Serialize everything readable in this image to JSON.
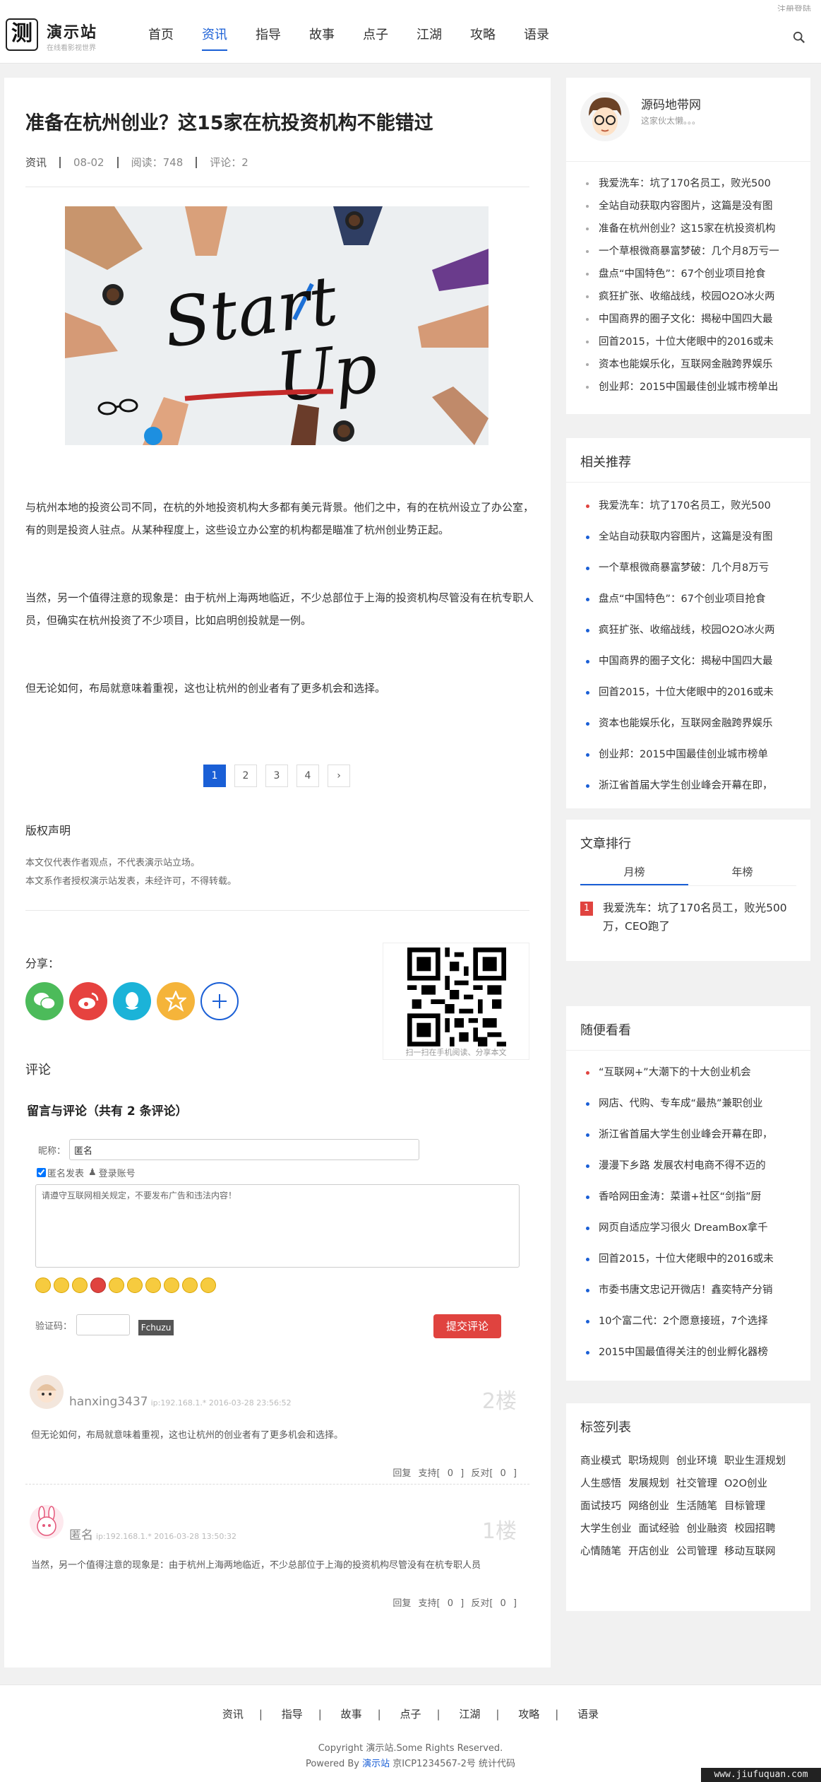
{
  "topbar": {
    "register_login": "注册登陆"
  },
  "logo": {
    "glyph": "测",
    "name": "演示站",
    "sub": "在线看影视世界"
  },
  "nav": {
    "items": [
      "首页",
      "资讯",
      "指导",
      "故事",
      "点子",
      "江湖",
      "攻略",
      "语录"
    ],
    "active_index": 1
  },
  "article": {
    "title": "准备在杭州创业？这15家在杭投资机构不能错过",
    "meta": {
      "category": "资讯",
      "date": "08-02",
      "reads": "阅读：748",
      "comments": "评论：2"
    },
    "hero_text": {
      "line1": "Start",
      "line2": "Up"
    },
    "paragraphs": [
      "与杭州本地的投资公司不同，在杭的外地投资机构大多都有美元背景。他们之中，有的在杭州设立了办公室，有的则是投资人驻点。从某种程度上，这些设立办公室的机构都是瞄准了杭州创业势正起。",
      "当然，另一个值得注意的现象是：由于杭州上海两地临近，不少总部位于上海的投资机构尽管没有在杭专职人员，但确实在杭州投资了不少项目，比如启明创投就是一例。",
      "但无论如何，布局就意味着重视，这也让杭州的创业者有了更多机会和选择。"
    ],
    "pager": [
      "1",
      "2",
      "3",
      "4",
      "›"
    ],
    "copyright": {
      "heading": "版权声明",
      "line1": "本文仅代表作者观点，不代表演示站立场。",
      "line2": "本文系作者授权演示站发表，未经许可，不得转载。"
    },
    "share": {
      "label": "分享：",
      "qr_caption": "扫一扫在手机阅读、分享本文"
    }
  },
  "comments": {
    "section_title": "评论",
    "heading": "留言与评论（共有 2 条评论）",
    "nick_label": "昵称：",
    "nick_value": "匿名",
    "anon_label": "匿名发表",
    "login_label": "登录账号",
    "textarea_placeholder": "请遵守互联网相关规定，不要发布广告和违法内容！",
    "captcha_label": "验证码：",
    "captcha_img": "Fchuzu",
    "submit_label": "提交评论",
    "items": [
      {
        "name": "hanxing3437",
        "ip": "ip:192.168.1.* 2016-03-28 23:56:52",
        "floor": "2楼",
        "text": "但无论如何，布局就意味着重视，这也让杭州的创业者有了更多机会和选择。",
        "actions": "回复 支持[ 0 ] 反对[ 0 ]"
      },
      {
        "name": "匿名",
        "ip": "ip:192.168.1.* 2016-03-28 13:50:32",
        "floor": "1楼",
        "text": "当然，另一个值得注意的现象是：由于杭州上海两地临近，不少总部位于上海的投资机构尽管没有在杭专职人员",
        "actions": "回复 支持[ 0 ] 反对[ 0 ]"
      }
    ]
  },
  "sidebar": {
    "profile": {
      "name": "源码地带网",
      "bio": "这家伙太懒。。。"
    },
    "latest": [
      "我爱洗车：坑了170名员工，败光500",
      "全站自动获取内容图片，这篇是没有图",
      "准备在杭州创业？这15家在杭投资机构",
      "一个草根微商暴富梦破：几个月8万亏一",
      "盘点“中国特色”：67个创业项目抢食",
      "疯狂扩张、收缩战线，校园O2O冰火两",
      "中国商界的圈子文化：揭秘中国四大最",
      "回首2015，十位大佬眼中的2016或未",
      "资本也能娱乐化，互联网金融跨界娱乐",
      "创业邦：2015中国最佳创业城市榜单出"
    ],
    "related": {
      "title": "相关推荐",
      "items": [
        "我爱洗车：坑了170名员工，败光500",
        "全站自动获取内容图片，这篇是没有图",
        "一个草根微商暴富梦破：几个月8万亏",
        "盘点“中国特色”：67个创业项目抢食",
        "疯狂扩张、收缩战线，校园O2O冰火两",
        "中国商界的圈子文化：揭秘中国四大最",
        "回首2015，十位大佬眼中的2016或未",
        "资本也能娱乐化，互联网金融跨界娱乐",
        "创业邦：2015中国最佳创业城市榜单",
        "浙江省首届大学生创业峰会开幕在即，"
      ]
    },
    "ranking": {
      "title": "文章排行",
      "tabs": [
        "月榜",
        "年榜"
      ],
      "top_no": "1",
      "top_title": "我爱洗车：坑了170名员工，败光500万，CEO跑了"
    },
    "random": {
      "title": "随便看看",
      "items": [
        "“互联网+”大潮下的十大创业机会",
        "网店、代购、专车成“最热”兼职创业",
        "浙江省首届大学生创业峰会开幕在即，",
        "漫漫下乡路 发展农村电商不得不迈的",
        "香哈网田金涛：菜谱+社区“剑指”厨",
        "网页自适应学习很火 DreamBox拿千",
        "回首2015，十位大佬眼中的2016或未",
        "市委书唐文忠记开微店！鑫奕特产分销",
        "10个富二代：2个愿意接班，7个选择",
        "2015中国最值得关注的创业孵化器榜"
      ]
    },
    "tags": {
      "title": "标签列表",
      "items": [
        "商业模式",
        "职场规则",
        "创业环境",
        "职业生涯规划",
        "人生感悟",
        "发展规划",
        "社交管理",
        "O2O创业",
        "面试技巧",
        "网络创业",
        "生活随笔",
        "目标管理",
        "大学生创业",
        "面试经验",
        "创业融资",
        "校园招聘",
        "心情随笔",
        "开店创业",
        "公司管理",
        "移动互联网"
      ]
    }
  },
  "footer": {
    "nav": [
      "资讯",
      "指导",
      "故事",
      "点子",
      "江湖",
      "攻略",
      "语录"
    ],
    "copyright": "Copyright 演示站.Some Rights Reserved.",
    "powered_prefix": "Powered By",
    "powered_brand": "演示站",
    "icp": "京ICP1234567-2号 统计代码"
  },
  "watermark": "www.jiufuquan.com",
  "colors": {
    "accent": "#1a5fd6",
    "danger": "#e0433f",
    "wechat": "#4cbb5a",
    "weibo": "#e6423f",
    "qq": "#1bb3d8",
    "qzone": "#f5b43a"
  }
}
